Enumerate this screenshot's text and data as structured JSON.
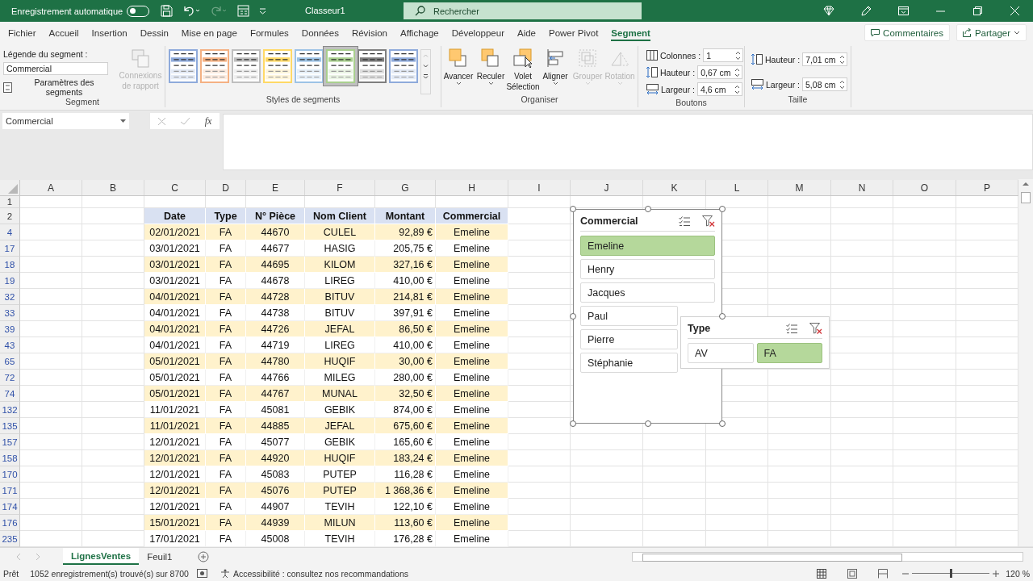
{
  "title_bar": {
    "autosave_label": "Enregistrement automatique",
    "autosave_on": false,
    "title": "Classeur1",
    "search_placeholder": "Rechercher"
  },
  "menu_tabs": [
    {
      "label": "Fichier",
      "selected": false
    },
    {
      "label": "Accueil",
      "selected": false
    },
    {
      "label": "Insertion",
      "selected": false
    },
    {
      "label": "Dessin",
      "selected": false
    },
    {
      "label": "Mise en page",
      "selected": false
    },
    {
      "label": "Formules",
      "selected": false
    },
    {
      "label": "Données",
      "selected": false
    },
    {
      "label": "Révision",
      "selected": false
    },
    {
      "label": "Affichage",
      "selected": false
    },
    {
      "label": "Développeur",
      "selected": false
    },
    {
      "label": "Aide",
      "selected": false
    },
    {
      "label": "Power Pivot",
      "selected": false
    },
    {
      "label": "Segment",
      "selected": true
    }
  ],
  "comments_button": "Commentaires",
  "share_button": "Partager",
  "ribbon": {
    "segment_group": {
      "caption_label": "Légende du segment :",
      "caption_value": "Commercial",
      "settings_button": "Paramètres des segments",
      "connections_button": {
        "label": "Connexions de rapport",
        "disabled": true
      },
      "label": "Segment"
    },
    "styles_group": {
      "label": "Styles de segments",
      "swatches": [
        {
          "color": "#8eaadb",
          "selected": false
        },
        {
          "color": "#f4b183",
          "selected": false
        },
        {
          "color": "#bfbfbf",
          "selected": false
        },
        {
          "color": "#ffd966",
          "selected": false
        },
        {
          "color": "#9dc3e6",
          "selected": false
        },
        {
          "color": "#a9d08e",
          "selected": true
        },
        {
          "color": "#7f7f7f",
          "selected": false
        },
        {
          "color": "#8eaadb",
          "selected": false
        }
      ]
    },
    "arrange_group": {
      "label": "Organiser",
      "buttons": [
        {
          "kind": "forward",
          "label": "Avancer",
          "disabled": false
        },
        {
          "kind": "backward",
          "label": "Reculer",
          "disabled": false
        },
        {
          "kind": "pane",
          "label": "Volet Sélection",
          "disabled": false
        },
        {
          "kind": "align",
          "label": "Aligner",
          "disabled": false
        },
        {
          "kind": "group",
          "label": "Grouper",
          "disabled": true
        },
        {
          "kind": "rotate",
          "label": "Rotation",
          "disabled": true
        }
      ]
    },
    "buttons_group": {
      "label": "Boutons",
      "fields": [
        {
          "kind": "columns",
          "label": "Colonnes :",
          "value": "1"
        },
        {
          "kind": "height",
          "label": "Hauteur :",
          "value": "0,67 cm"
        },
        {
          "kind": "width",
          "label": "Largeur :",
          "value": "4,6 cm"
        }
      ]
    },
    "size_group": {
      "label": "Taille",
      "fields": [
        {
          "kind": "height",
          "label": "Hauteur :",
          "value": "7,01 cm"
        },
        {
          "kind": "width",
          "label": "Largeur :",
          "value": "5,08 cm"
        }
      ]
    }
  },
  "formula_bar": {
    "name_box": "Commercial",
    "function_label": "fx"
  },
  "sheet": {
    "columns": [
      "A",
      "B",
      "C",
      "D",
      "E",
      "F",
      "G",
      "H",
      "I",
      "J",
      "K",
      "L",
      "M",
      "N",
      "O",
      "P"
    ],
    "rows": [
      {
        "number": "1",
        "filtered": false,
        "kind": "blank"
      },
      {
        "number": "2",
        "filtered": false,
        "kind": "header",
        "cells": [
          "Date",
          "Type",
          "N° Pièce",
          "Nom Client",
          "Montant",
          "Commercial"
        ]
      },
      {
        "number": "4",
        "filtered": true,
        "kind": "data",
        "cells": [
          "02/01/2021",
          "FA",
          "44670",
          "CULEL",
          "92,89 €",
          "Emeline"
        ]
      },
      {
        "number": "17",
        "filtered": true,
        "kind": "data",
        "cells": [
          "03/01/2021",
          "FA",
          "44677",
          "HASIG",
          "205,75 €",
          "Emeline"
        ]
      },
      {
        "number": "18",
        "filtered": true,
        "kind": "data",
        "cells": [
          "03/01/2021",
          "FA",
          "44695",
          "KILOM",
          "327,16 €",
          "Emeline"
        ]
      },
      {
        "number": "19",
        "filtered": true,
        "kind": "data",
        "cells": [
          "03/01/2021",
          "FA",
          "44678",
          "LIREG",
          "410,00 €",
          "Emeline"
        ]
      },
      {
        "number": "32",
        "filtered": true,
        "kind": "data",
        "cells": [
          "04/01/2021",
          "FA",
          "44728",
          "BITUV",
          "214,81 €",
          "Emeline"
        ]
      },
      {
        "number": "33",
        "filtered": true,
        "kind": "data",
        "cells": [
          "04/01/2021",
          "FA",
          "44738",
          "BITUV",
          "397,91 €",
          "Emeline"
        ]
      },
      {
        "number": "39",
        "filtered": true,
        "kind": "data",
        "cells": [
          "04/01/2021",
          "FA",
          "44726",
          "JEFAL",
          "86,50 €",
          "Emeline"
        ]
      },
      {
        "number": "43",
        "filtered": true,
        "kind": "data",
        "cells": [
          "04/01/2021",
          "FA",
          "44719",
          "LIREG",
          "410,00 €",
          "Emeline"
        ]
      },
      {
        "number": "65",
        "filtered": true,
        "kind": "data",
        "cells": [
          "05/01/2021",
          "FA",
          "44780",
          "HUQIF",
          "30,00 €",
          "Emeline"
        ]
      },
      {
        "number": "72",
        "filtered": true,
        "kind": "data",
        "cells": [
          "05/01/2021",
          "FA",
          "44766",
          "MILEG",
          "280,00 €",
          "Emeline"
        ]
      },
      {
        "number": "74",
        "filtered": true,
        "kind": "data",
        "cells": [
          "05/01/2021",
          "FA",
          "44767",
          "MUNAL",
          "32,50 €",
          "Emeline"
        ]
      },
      {
        "number": "132",
        "filtered": true,
        "kind": "data",
        "cells": [
          "11/01/2021",
          "FA",
          "45081",
          "GEBIK",
          "874,00 €",
          "Emeline"
        ]
      },
      {
        "number": "135",
        "filtered": true,
        "kind": "data",
        "cells": [
          "11/01/2021",
          "FA",
          "44885",
          "JEFAL",
          "675,60 €",
          "Emeline"
        ]
      },
      {
        "number": "157",
        "filtered": true,
        "kind": "data",
        "cells": [
          "12/01/2021",
          "FA",
          "45077",
          "GEBIK",
          "165,60 €",
          "Emeline"
        ]
      },
      {
        "number": "158",
        "filtered": true,
        "kind": "data",
        "cells": [
          "12/01/2021",
          "FA",
          "44920",
          "HUQIF",
          "183,24 €",
          "Emeline"
        ]
      },
      {
        "number": "170",
        "filtered": true,
        "kind": "data",
        "cells": [
          "12/01/2021",
          "FA",
          "45083",
          "PUTEP",
          "116,28 €",
          "Emeline"
        ]
      },
      {
        "number": "171",
        "filtered": true,
        "kind": "data",
        "cells": [
          "12/01/2021",
          "FA",
          "45076",
          "PUTEP",
          "1 368,36 €",
          "Emeline"
        ]
      },
      {
        "number": "174",
        "filtered": true,
        "kind": "data",
        "cells": [
          "12/01/2021",
          "FA",
          "44907",
          "TEVIH",
          "122,10 €",
          "Emeline"
        ]
      },
      {
        "number": "176",
        "filtered": true,
        "kind": "data",
        "cells": [
          "15/01/2021",
          "FA",
          "44939",
          "MILUN",
          "113,60 €",
          "Emeline"
        ]
      },
      {
        "number": "235",
        "filtered": true,
        "kind": "data",
        "cells": [
          "17/01/2021",
          "FA",
          "45008",
          "TEVIH",
          "176,28 €",
          "Emeline"
        ]
      }
    ]
  },
  "slicers": [
    {
      "title": "Commercial",
      "selected": true,
      "items": [
        {
          "label": "Emeline",
          "selected": true
        },
        {
          "label": "Henry",
          "selected": false
        },
        {
          "label": "Jacques",
          "selected": false
        },
        {
          "label": "Paul",
          "selected": false
        },
        {
          "label": "Pierre",
          "selected": false
        },
        {
          "label": "Stéphanie",
          "selected": false
        }
      ]
    },
    {
      "title": "Type",
      "selected": false,
      "items": [
        {
          "label": "AV",
          "selected": false
        },
        {
          "label": "FA",
          "selected": true
        }
      ]
    }
  ],
  "sheet_tabs": [
    {
      "label": "LignesVentes",
      "selected": true
    },
    {
      "label": "Feuil1",
      "selected": false
    }
  ],
  "status_bar": {
    "mode": "Prêt",
    "records": "1052 enregistrement(s) trouvé(s) sur 8700",
    "accessibility": "Accessibilité : consultez nos recommandations",
    "zoom": {
      "label": "120 %",
      "level": 0.5
    }
  }
}
